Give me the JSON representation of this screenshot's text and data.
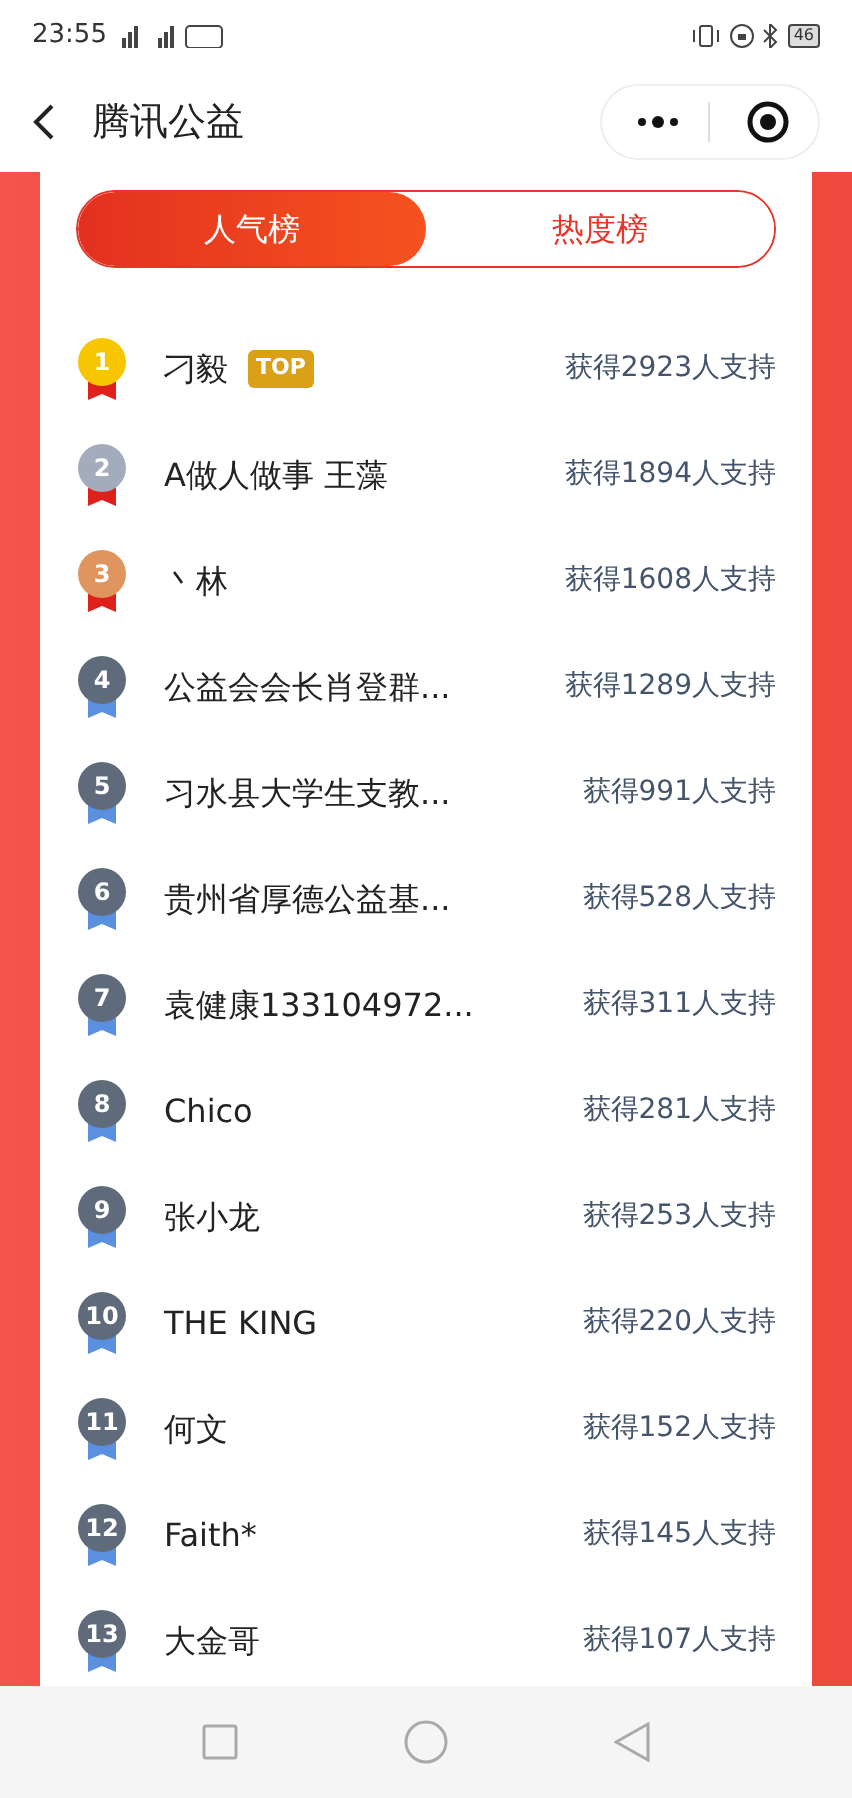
{
  "status_bar": {
    "time": "23:55",
    "battery": "46"
  },
  "header": {
    "title": "腾讯公益"
  },
  "tabs": [
    {
      "label": "人气榜",
      "selected": true
    },
    {
      "label": "热度榜",
      "selected": false
    }
  ],
  "ranking": [
    {
      "rank": "1",
      "kind": "podium",
      "color": "#f7c600",
      "name": "刁毅",
      "badge": "TOP",
      "support": "获得2923人支持"
    },
    {
      "rank": "2",
      "kind": "podium",
      "color": "#a3acbb",
      "name": "A做人做事 王藻",
      "support": "获得1894人支持"
    },
    {
      "rank": "3",
      "kind": "podium",
      "color": "#e0955e",
      "name": "丶林",
      "support": "获得1608人支持"
    },
    {
      "rank": "4",
      "kind": "standard",
      "color": "#5f6b7b",
      "name": "公益会会长肖登群...",
      "support": "获得1289人支持"
    },
    {
      "rank": "5",
      "kind": "standard",
      "color": "#5f6b7b",
      "name": "习水县大学生支教...",
      "support": "获得991人支持"
    },
    {
      "rank": "6",
      "kind": "standard",
      "color": "#5f6b7b",
      "name": "贵州省厚德公益基...",
      "support": "获得528人支持"
    },
    {
      "rank": "7",
      "kind": "standard",
      "color": "#5f6b7b",
      "name": "袁健康133104972...",
      "support": "获得311人支持"
    },
    {
      "rank": "8",
      "kind": "standard",
      "color": "#5f6b7b",
      "name": "Chico",
      "support": "获得281人支持"
    },
    {
      "rank": "9",
      "kind": "standard",
      "color": "#5f6b7b",
      "name": "张小龙",
      "support": "获得253人支持"
    },
    {
      "rank": "10",
      "kind": "standard",
      "color": "#5f6b7b",
      "name": "THE KING",
      "support": "获得220人支持"
    },
    {
      "rank": "11",
      "kind": "standard",
      "color": "#5f6b7b",
      "name": "何文",
      "support": "获得152人支持"
    },
    {
      "rank": "12",
      "kind": "standard",
      "color": "#5f6b7b",
      "name": "Faith*",
      "support": "获得145人支持"
    },
    {
      "rank": "13",
      "kind": "standard",
      "color": "#5f6b7b",
      "name": "大金哥",
      "support": "获得107人支持"
    }
  ]
}
